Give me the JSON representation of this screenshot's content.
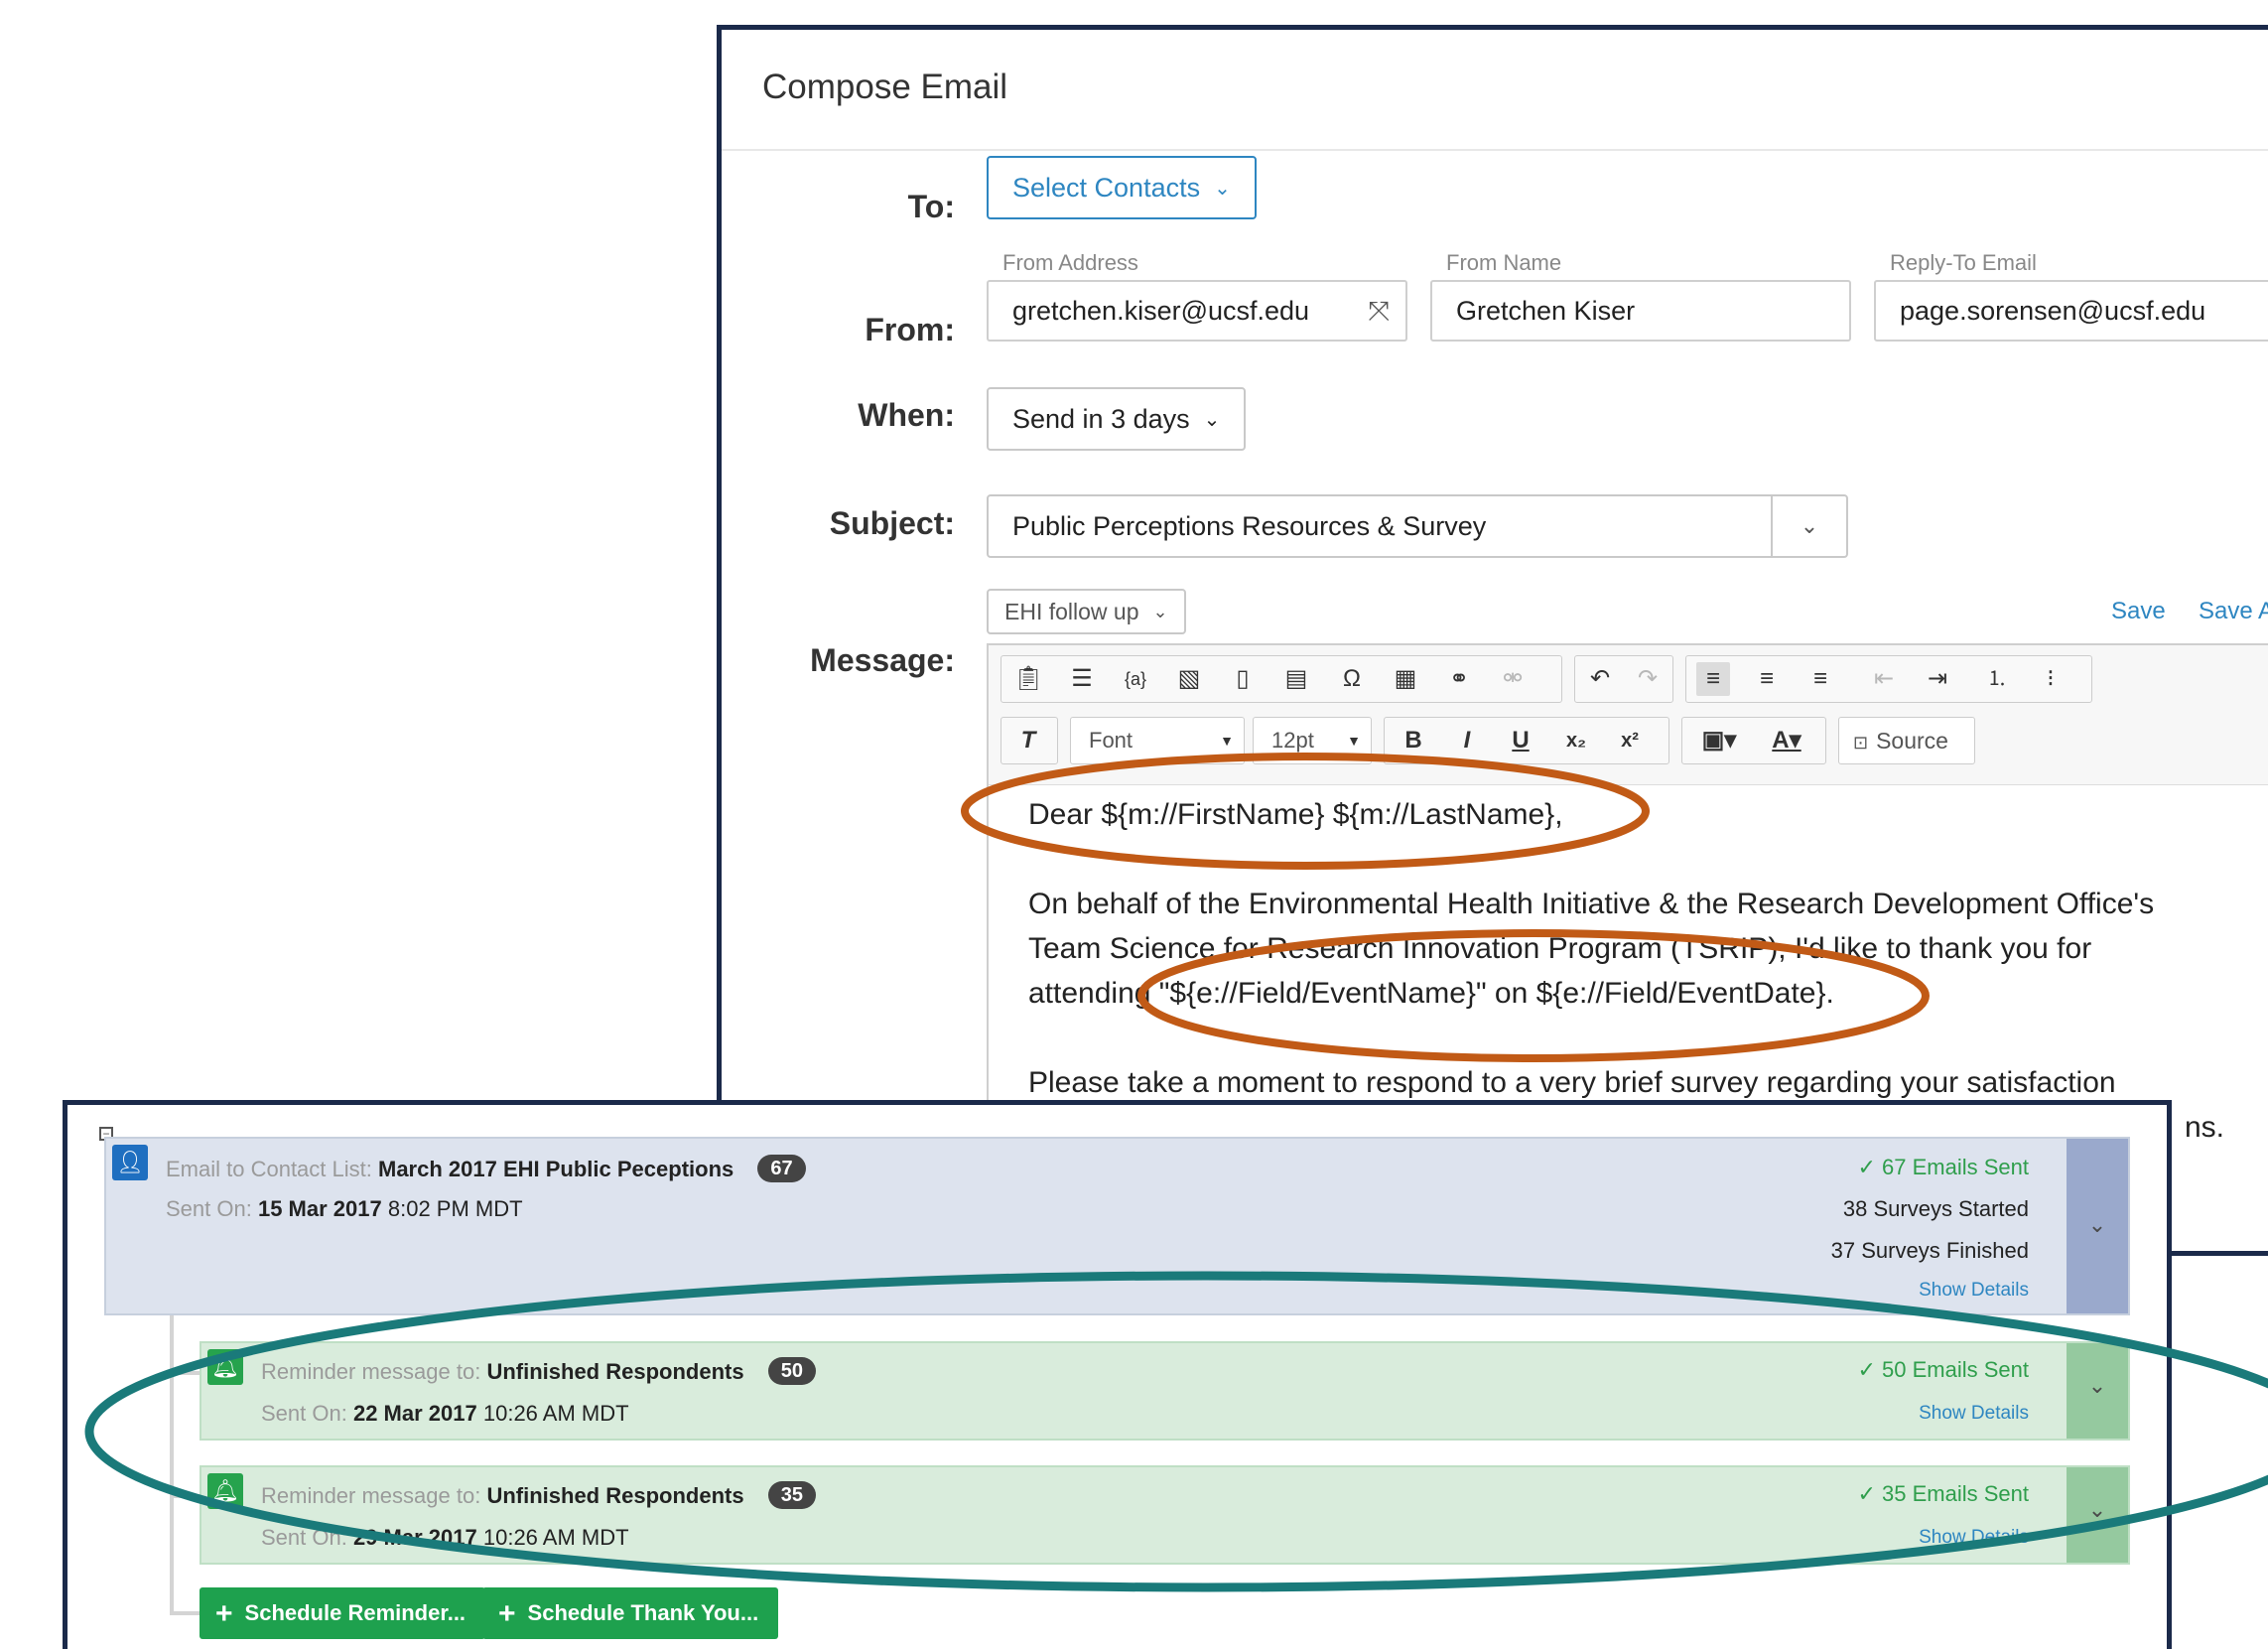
{
  "heading_partial": "",
  "compose": {
    "title": "Compose Email",
    "to_label": "To:",
    "to_button": "Select Contacts",
    "from_label": "From:",
    "from_address_caption": "From Address",
    "from_address": "gretchen.kiser@ucsf.edu",
    "from_name_caption": "From Name",
    "from_name": "Gretchen Kiser",
    "reply_to_caption": "Reply-To Email",
    "reply_to": "page.sorensen@ucsf.edu",
    "when_label": "When:",
    "when_value": "Send in 3 days",
    "subject_label": "Subject:",
    "subject_value": "Public Perceptions Resources & Survey",
    "message_label": "Message:",
    "template_select": "EHI follow up",
    "save_link": "Save",
    "save_as_link": "Save A",
    "toolbar": {
      "font_combo": "Font",
      "size_combo": "12pt",
      "source_button": "Source"
    },
    "body_lines": [
      "Dear ${m://FirstName} ${m://LastName},",
      "On behalf of the Environmental Health Initiative & the Research Development Office's",
      "Team Science for Research Innovation Program (TSRIP), I'd like to thank you for",
      "attending \"${e://Field/EventName}\" on ${e://Field/EventDate}.",
      "Please take a moment to respond to a very brief survey regarding your satisfaction",
      "ns."
    ]
  },
  "history": {
    "main": {
      "prefix": "Email to Contact List:",
      "list_name": "March 2017 EHI Public Peceptions",
      "count": "67",
      "sent_on_label": "Sent On:",
      "sent_on_date": "15 Mar 2017",
      "sent_on_time": "8:02 PM MDT",
      "emails_sent": "67 Emails Sent",
      "surveys_started": "38 Surveys Started",
      "surveys_finished": "37 Surveys Finished",
      "show_details": "Show Details"
    },
    "reminders": [
      {
        "prefix": "Reminder message to:",
        "target": "Unfinished Respondents",
        "count": "50",
        "sent_on_label": "Sent On:",
        "sent_on_date": "22 Mar 2017",
        "sent_on_time": "10:26 AM MDT",
        "emails_sent": "50 Emails Sent",
        "show_details": "Show Details"
      },
      {
        "prefix": "Reminder message to:",
        "target": "Unfinished Respondents",
        "count": "35",
        "sent_on_label": "Sent On:",
        "sent_on_date": "29 Mar 2017",
        "sent_on_time": "10:26 AM MDT",
        "emails_sent": "35 Emails Sent",
        "show_details": "Show Details"
      }
    ],
    "schedule_reminder": "Schedule Reminder...",
    "schedule_thank_you": "Schedule Thank You..."
  },
  "colors": {
    "annotation_orange": "#c15a16",
    "annotation_teal": "#1a7a7a",
    "frame_navy": "#1b2a4a",
    "action_green": "#1ea14e"
  }
}
